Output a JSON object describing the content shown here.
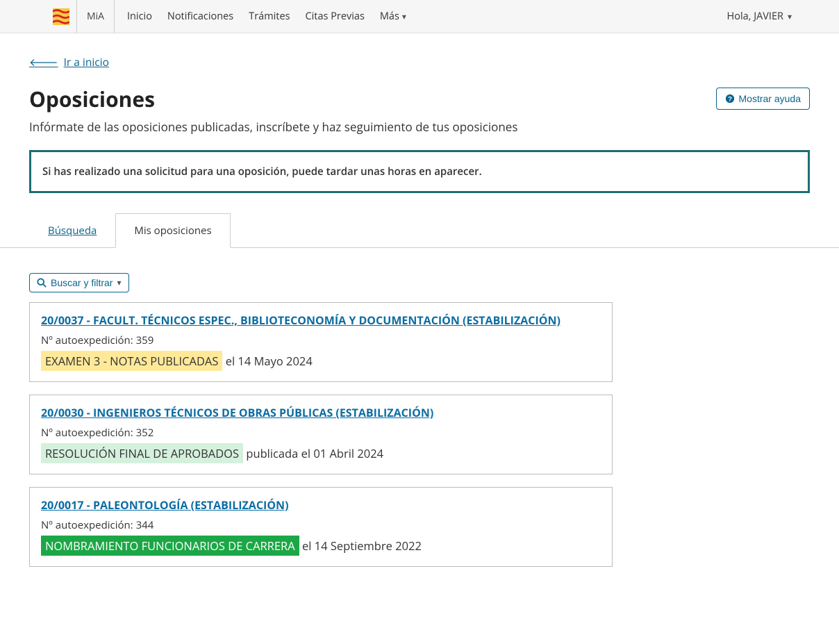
{
  "nav": {
    "brand": "MiA",
    "links": {
      "inicio": "Inicio",
      "notificaciones": "Notificaciones",
      "tramites": "Trámites",
      "citas": "Citas Previas",
      "mas": "Más"
    },
    "user": "Hola, JAVIER"
  },
  "back_link": "Ir a inicio",
  "page_title": "Oposiciones",
  "subtitle": "Infórmate de las oposiciones publicadas, inscríbete y haz seguimiento de tus oposiciones",
  "help_button": "Mostrar ayuda",
  "info_box": "Si has realizado una solicitud para una oposición, puede tardar unas horas en aparecer.",
  "tabs": {
    "busqueda": "Búsqueda",
    "mis_oposiciones": "Mis oposiciones"
  },
  "filter_button": "Buscar y filtrar",
  "cards": [
    {
      "title": "20/0037 - FACULT. TÉCNICOS ESPEC., BIBLIOTECONOMÍA Y DOCUMENTACIÓN (ESTABILIZACIÓN)",
      "autoexp_label": "Nº autoexpedición: 359",
      "status": "EXAMEN 3 - NOTAS PUBLICADAS",
      "status_suffix": " el 14 Mayo 2024",
      "badge_class": "badge-yellow"
    },
    {
      "title": "20/0030 - INGENIEROS TÉCNICOS DE OBRAS PÚBLICAS (ESTABILIZACIÓN)",
      "autoexp_label": "Nº autoexpedición: 352",
      "status": "RESOLUCIÓN FINAL DE APROBADOS",
      "status_suffix": " publicada el 01 Abril 2024",
      "badge_class": "badge-lightgreen"
    },
    {
      "title": "20/0017 - PALEONTOLOGÍA (ESTABILIZACIÓN)",
      "autoexp_label": "Nº autoexpedición: 344",
      "status": "NOMBRAMIENTO FUNCIONARIOS DE CARRERA",
      "status_suffix": " el 14 Septiembre 2022",
      "badge_class": "badge-green"
    }
  ]
}
